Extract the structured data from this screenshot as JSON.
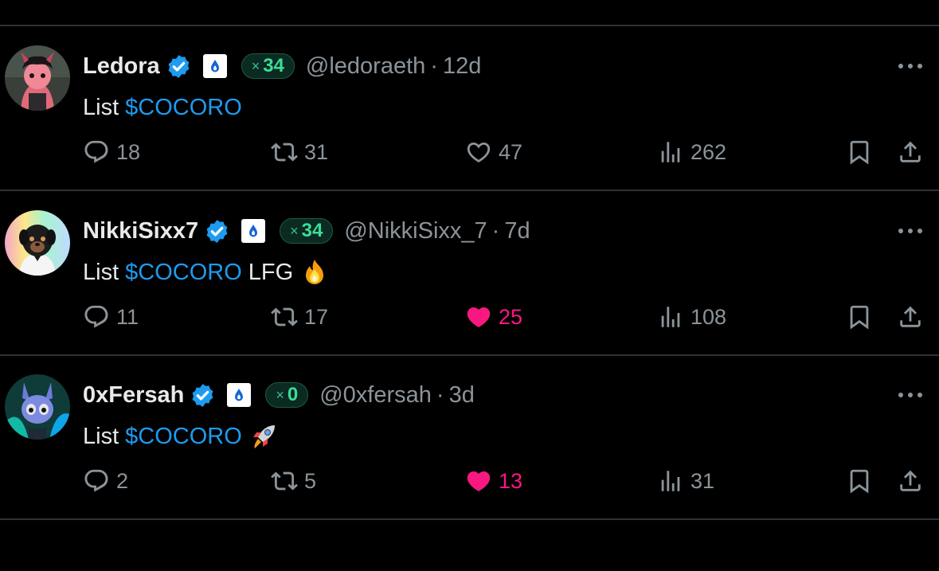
{
  "colors": {
    "background": "#000000",
    "text": "#e7e9ea",
    "muted": "#8b949a",
    "cashtag": "#1d9bf0",
    "like_active": "#f91880",
    "xp_text": "#3ddc97",
    "divider": "#2f3336"
  },
  "tweets": [
    {
      "display_name": "Ledora",
      "verified_icon": "verified-badge-icon",
      "affiliate_icon": "flame-drop-icon",
      "xp_count": "34",
      "xp_prefix": "×",
      "handle": "@ledoraeth",
      "separator": "·",
      "time": "12d",
      "text": "List",
      "cashtag": "$COCORO",
      "extra_text": "",
      "emoji": "",
      "replies": "18",
      "retweets": "31",
      "likes": "47",
      "liked": false,
      "views": "262"
    },
    {
      "display_name": "NikkiSixx7",
      "verified_icon": "verified-badge-icon",
      "affiliate_icon": "flame-drop-icon",
      "xp_count": "34",
      "xp_prefix": "×",
      "handle": "@NikkiSixx_7",
      "separator": "·",
      "time": "7d",
      "text": "List",
      "cashtag": "$COCORO",
      "extra_text": "LFG",
      "emoji": "fire-emoji",
      "replies": "11",
      "retweets": "17",
      "likes": "25",
      "liked": true,
      "views": "108"
    },
    {
      "display_name": "0xFersah",
      "verified_icon": "verified-badge-icon",
      "affiliate_icon": "flame-drop-icon",
      "xp_count": "0",
      "xp_prefix": "×",
      "handle": "@0xfersah",
      "separator": "·",
      "time": "3d",
      "text": "List",
      "cashtag": "$COCORO",
      "extra_text": "",
      "emoji": "rocket-emoji",
      "replies": "2",
      "retweets": "5",
      "likes": "13",
      "liked": true,
      "views": "31"
    }
  ]
}
